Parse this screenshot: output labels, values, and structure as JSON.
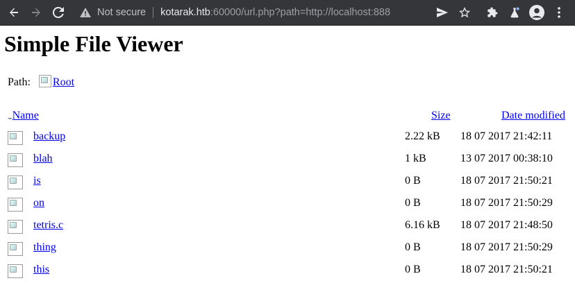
{
  "browser": {
    "security_label": "Not secure",
    "url_host": "kotarak.htb",
    "url_rest": ":60000/url.php?path=http://localhost:888"
  },
  "page": {
    "title": "Simple File Viewer",
    "path_label": "Path:",
    "root_link": "Root"
  },
  "table": {
    "headers": {
      "name": "Name",
      "size": "Size",
      "date": "Date modified"
    },
    "rows": [
      {
        "name": "backup",
        "size": "2.22 kB",
        "date": "18 07 2017 21:42:11"
      },
      {
        "name": "blah",
        "size": "1 kB",
        "date": "13 07 2017 00:38:10"
      },
      {
        "name": "is",
        "size": "0 B",
        "date": "18 07 2017 21:50:21"
      },
      {
        "name": "on",
        "size": "0 B",
        "date": "18 07 2017 21:50:29"
      },
      {
        "name": "tetris.c",
        "size": "6.16 kB",
        "date": "18 07 2017 21:48:50"
      },
      {
        "name": "thing",
        "size": "0 B",
        "date": "18 07 2017 21:50:29"
      },
      {
        "name": "this",
        "size": "0 B",
        "date": "18 07 2017 21:50:21"
      }
    ]
  }
}
